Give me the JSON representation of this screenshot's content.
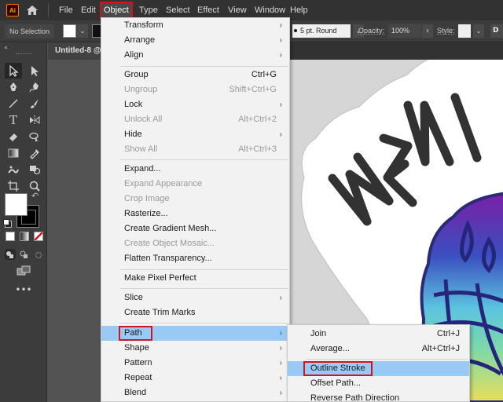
{
  "app": {
    "logo_text": "Ai",
    "colors": {
      "menu_highlight": "#99c9f5",
      "callout_red": "#d2141c",
      "menubar_bg": "#323232"
    }
  },
  "menubar": {
    "items": [
      "File",
      "Edit",
      "Object",
      "Type",
      "Select",
      "Effect",
      "View",
      "Window",
      "Help"
    ],
    "active": "Object"
  },
  "controlbar": {
    "selection_label": "No Selection",
    "stroke_profile": "5 pt. Round",
    "opacity_label": "Opacity:",
    "opacity_value": "100%",
    "style_label": "Style:",
    "doc_setup_label": "D"
  },
  "document": {
    "tab_title": "Untitled-8 @"
  },
  "toolbar": {
    "tools": [
      "selection-tool",
      "direct-selection-tool",
      "pen-tool",
      "curvature-tool",
      "line-segment-tool",
      "paintbrush-tool",
      "type-tool",
      "reflect-tool",
      "eraser-tool",
      "lasso-tool",
      "gradient-tool",
      "eyedropper-tool",
      "puppet-warp-tool",
      "shape-builder-tool",
      "artboard-tool",
      "zoom-tool"
    ],
    "more_label": "•••"
  },
  "object_menu": {
    "items": [
      {
        "label": "Transform",
        "submenu": true,
        "disabled": false
      },
      {
        "label": "Arrange",
        "submenu": true,
        "disabled": false
      },
      {
        "label": "Align",
        "submenu": true,
        "disabled": false
      },
      {
        "label": "Group",
        "shortcut": "Ctrl+G",
        "disabled": false
      },
      {
        "label": "Ungroup",
        "shortcut": "Shift+Ctrl+G",
        "disabled": true
      },
      {
        "label": "Lock",
        "submenu": true,
        "disabled": false
      },
      {
        "label": "Unlock All",
        "shortcut": "Alt+Ctrl+2",
        "disabled": true
      },
      {
        "label": "Hide",
        "submenu": true,
        "disabled": false
      },
      {
        "label": "Show All",
        "shortcut": "Alt+Ctrl+3",
        "disabled": true
      },
      {
        "label": "Expand...",
        "disabled": false
      },
      {
        "label": "Expand Appearance",
        "disabled": true
      },
      {
        "label": "Crop Image",
        "disabled": true
      },
      {
        "label": "Rasterize...",
        "disabled": false
      },
      {
        "label": "Create Gradient Mesh...",
        "disabled": false
      },
      {
        "label": "Create Object Mosaic...",
        "disabled": true
      },
      {
        "label": "Flatten Transparency...",
        "disabled": false
      },
      {
        "label": "Make Pixel Perfect",
        "disabled": false
      },
      {
        "label": "Slice",
        "submenu": true,
        "disabled": false
      },
      {
        "label": "Create Trim Marks",
        "disabled": false
      },
      {
        "label": "Path",
        "submenu": true,
        "disabled": false,
        "highlighted": true
      },
      {
        "label": "Shape",
        "submenu": true,
        "disabled": false
      },
      {
        "label": "Pattern",
        "submenu": true,
        "disabled": false
      },
      {
        "label": "Repeat",
        "submenu": true,
        "disabled": false
      },
      {
        "label": "Blend",
        "submenu": true,
        "disabled": false
      }
    ]
  },
  "path_submenu": {
    "items": [
      {
        "label": "Join",
        "shortcut": "Ctrl+J"
      },
      {
        "label": "Average...",
        "shortcut": "Alt+Ctrl+J"
      },
      {
        "label": "Outline Stroke",
        "highlighted": true
      },
      {
        "label": "Offset Path..."
      },
      {
        "label": "Reverse Path Direction"
      }
    ]
  },
  "artwork": {
    "visible_text": "MEN"
  }
}
